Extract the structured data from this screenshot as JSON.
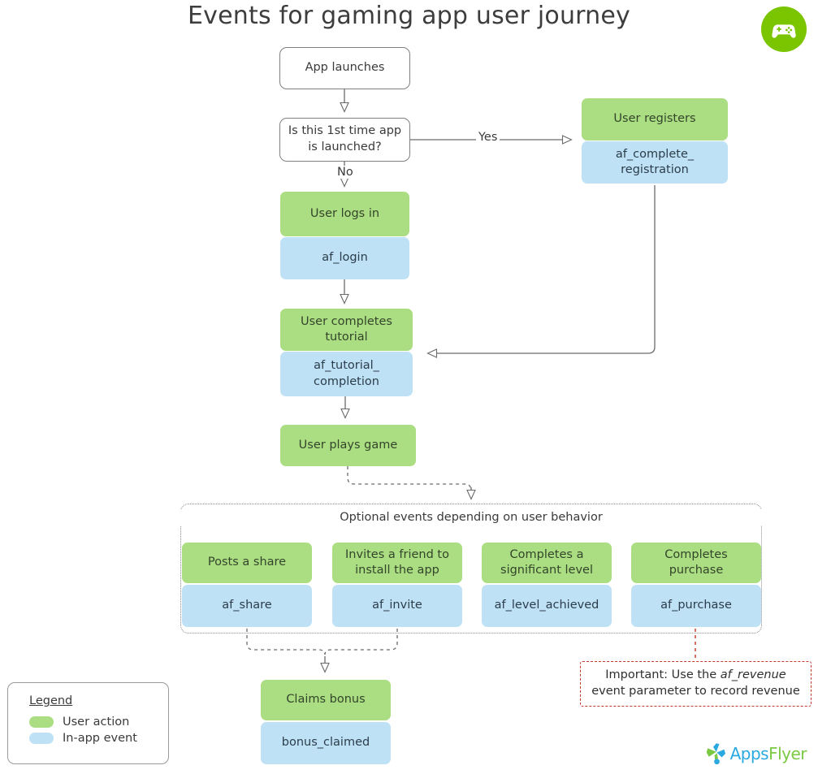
{
  "title": "Events for gaming app user journey",
  "brand": {
    "badge_icon": "gamepad-icon",
    "badge_color": "#7ac400",
    "logo_apps": "Apps",
    "logo_flyer": "Flyer"
  },
  "colors": {
    "user_action": "#abdd82",
    "in_app_event": "#bfe1f5",
    "important": "#c0392b",
    "line": "#6b6b6b"
  },
  "flow": {
    "app_launches": "App launches",
    "decision": "Is this 1st time app is launched?",
    "label_yes": "Yes",
    "label_no": "No",
    "register_action": "User registers",
    "register_event": "af_complete_ registration",
    "login_action": "User logs in",
    "login_event": "af_login",
    "tutorial_action": "User completes tutorial",
    "tutorial_event": "af_tutorial_ completion",
    "plays_action": "User plays game"
  },
  "optional": {
    "group_title": "Optional events depending on user behavior",
    "items": [
      {
        "action": "Posts a share",
        "event": "af_share"
      },
      {
        "action": "Invites a friend to install the app",
        "event": "af_invite"
      },
      {
        "action": "Completes a significant level",
        "event": "af_level_achieved"
      },
      {
        "action": "Completes purchase",
        "event": "af_purchase"
      }
    ],
    "bonus_action": "Claims bonus",
    "bonus_event": "bonus_claimed"
  },
  "important_note": {
    "prefix": "Important: Use the ",
    "emphasis": "af_revenue",
    "suffix": " event parameter to record revenue"
  },
  "legend": {
    "title": "Legend",
    "items": [
      {
        "label": "User action",
        "color": "#abdd82"
      },
      {
        "label": "In-app event",
        "color": "#bfe1f5"
      }
    ]
  }
}
